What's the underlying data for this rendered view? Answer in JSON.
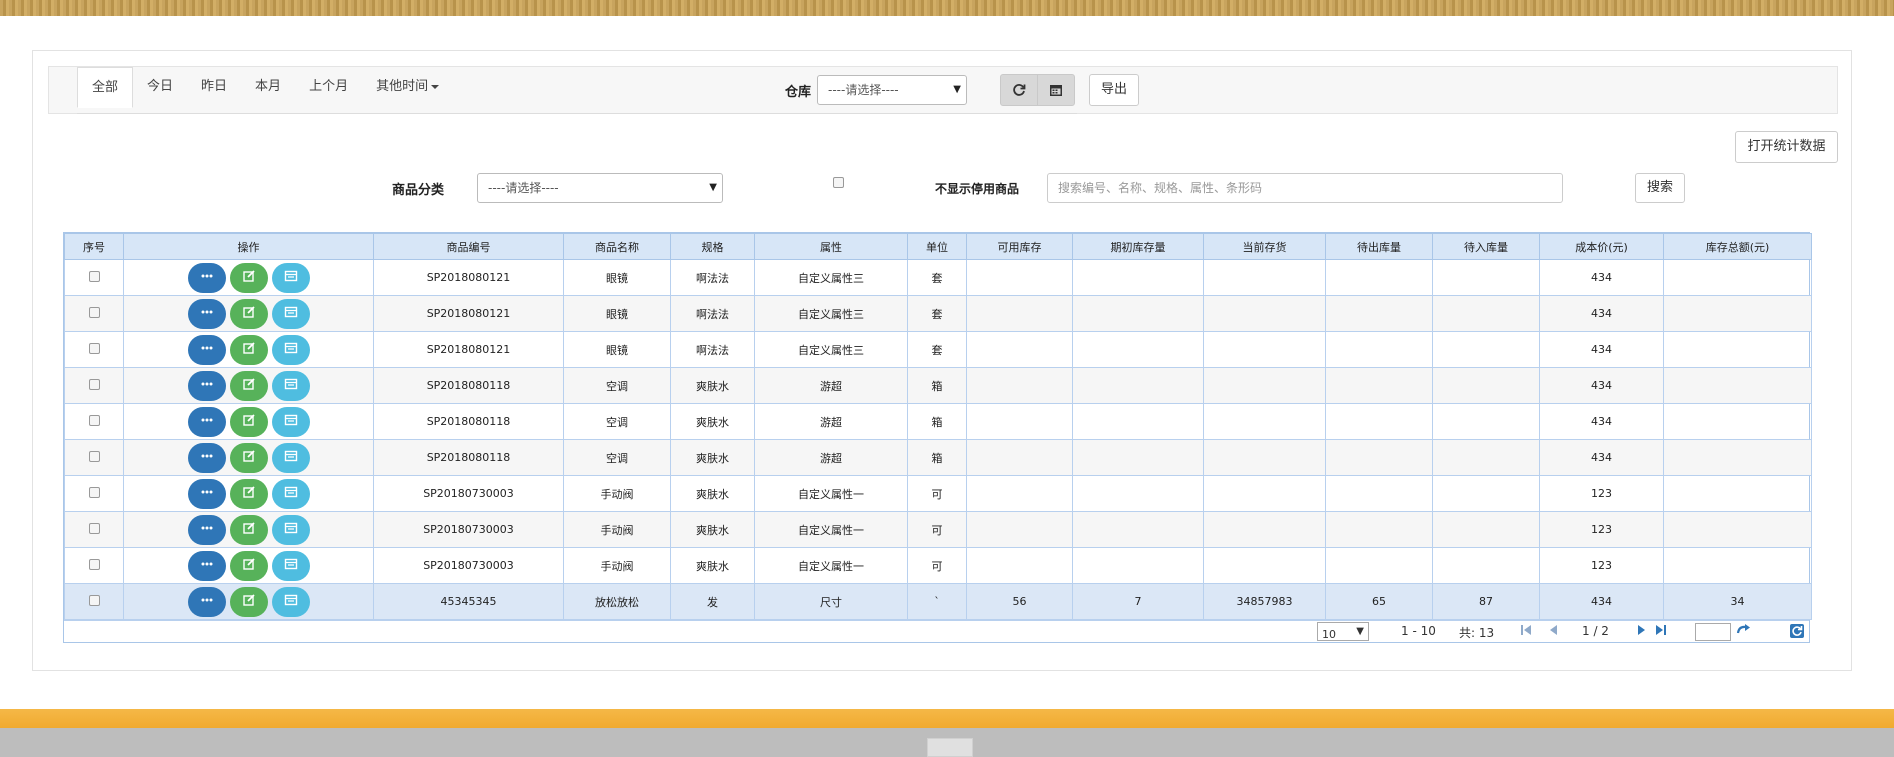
{
  "tabs": [
    "全部",
    "今日",
    "昨日",
    "本月",
    "上个月",
    "其他时间"
  ],
  "warehouse": {
    "label": "仓库",
    "placeholder": "----请选择----"
  },
  "actions": {
    "export": "导出",
    "open_stats": "打开统计数据",
    "search": "搜索"
  },
  "category": {
    "label": "商品分类",
    "placeholder": "----请选择----"
  },
  "hide_disabled_label": "不显示停用商品",
  "search_placeholder": "搜索编号、名称、规格、属性、条形码",
  "columns": [
    "序号",
    "操作",
    "商品编号",
    "商品名称",
    "规格",
    "属性",
    "单位",
    "可用库存",
    "期初库存量",
    "当前存货",
    "待出库量",
    "待入库量",
    "成本价(元)",
    "库存总额(元)"
  ],
  "rows": [
    {
      "code": "SP2018080121",
      "name": "眼镜",
      "spec": "啊法法",
      "attr": "自定义属性三",
      "unit": "套",
      "avail": "",
      "initial": "",
      "current": "",
      "out": "",
      "in": "",
      "cost": "434",
      "total": ""
    },
    {
      "code": "SP2018080121",
      "name": "眼镜",
      "spec": "啊法法",
      "attr": "自定义属性三",
      "unit": "套",
      "avail": "",
      "initial": "",
      "current": "",
      "out": "",
      "in": "",
      "cost": "434",
      "total": ""
    },
    {
      "code": "SP2018080121",
      "name": "眼镜",
      "spec": "啊法法",
      "attr": "自定义属性三",
      "unit": "套",
      "avail": "",
      "initial": "",
      "current": "",
      "out": "",
      "in": "",
      "cost": "434",
      "total": ""
    },
    {
      "code": "SP2018080118",
      "name": "空调",
      "spec": "爽肤水",
      "attr": "游超",
      "unit": "箱",
      "avail": "",
      "initial": "",
      "current": "",
      "out": "",
      "in": "",
      "cost": "434",
      "total": ""
    },
    {
      "code": "SP2018080118",
      "name": "空调",
      "spec": "爽肤水",
      "attr": "游超",
      "unit": "箱",
      "avail": "",
      "initial": "",
      "current": "",
      "out": "",
      "in": "",
      "cost": "434",
      "total": ""
    },
    {
      "code": "SP2018080118",
      "name": "空调",
      "spec": "爽肤水",
      "attr": "游超",
      "unit": "箱",
      "avail": "",
      "initial": "",
      "current": "",
      "out": "",
      "in": "",
      "cost": "434",
      "total": ""
    },
    {
      "code": "SP20180730003",
      "name": "手动阀",
      "spec": "爽肤水",
      "attr": "自定义属性一",
      "unit": "可",
      "avail": "",
      "initial": "",
      "current": "",
      "out": "",
      "in": "",
      "cost": "123",
      "total": ""
    },
    {
      "code": "SP20180730003",
      "name": "手动阀",
      "spec": "爽肤水",
      "attr": "自定义属性一",
      "unit": "可",
      "avail": "",
      "initial": "",
      "current": "",
      "out": "",
      "in": "",
      "cost": "123",
      "total": ""
    },
    {
      "code": "SP20180730003",
      "name": "手动阀",
      "spec": "爽肤水",
      "attr": "自定义属性一",
      "unit": "可",
      "avail": "",
      "initial": "",
      "current": "",
      "out": "",
      "in": "",
      "cost": "123",
      "total": ""
    },
    {
      "code": "45345345",
      "name": "放松放松",
      "spec": "发",
      "attr": "尺寸",
      "unit": "`",
      "avail": "56",
      "initial": "7",
      "current": "34857983",
      "out": "65",
      "in": "87",
      "cost": "434",
      "total": "34"
    }
  ],
  "pager": {
    "page_size": "10",
    "range": "1 - 10",
    "total": "共: 13",
    "page": "1 / 2"
  }
}
